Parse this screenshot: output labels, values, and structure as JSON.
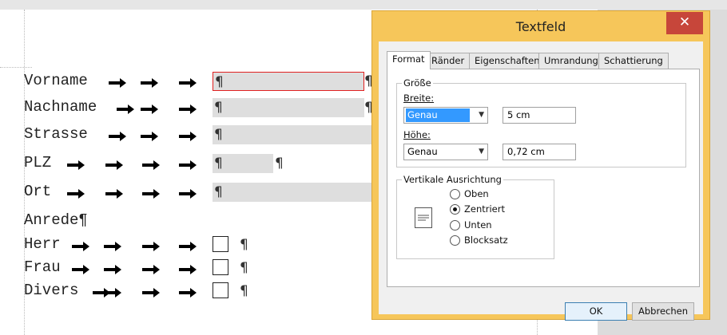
{
  "document": {
    "pilcrow": "¶",
    "rows": [
      {
        "label": "Vorname"
      },
      {
        "label": "Nachname"
      },
      {
        "label": "Strasse"
      },
      {
        "label": "PLZ"
      },
      {
        "label": "Ort"
      }
    ],
    "anrede": {
      "label": "Anrede¶"
    },
    "checkboxes": [
      {
        "label": "Herr"
      },
      {
        "label": "Frau"
      },
      {
        "label": "Divers"
      }
    ]
  },
  "dialog": {
    "title": "Textfeld",
    "close": "✕",
    "tabs": [
      "Format",
      "Ränder",
      "Eigenschaften",
      "Umrandung",
      "Schattierung"
    ],
    "selected_tab": "Format",
    "size_group": {
      "legend": "Größe",
      "width_label": "Breite:",
      "width_mode": "Genau",
      "width_value": "5 cm",
      "height_label": "Höhe:",
      "height_mode": "Genau",
      "height_value": "0,72 cm"
    },
    "align_group": {
      "legend": "Vertikale Ausrichtung",
      "options": [
        "Oben",
        "Zentriert",
        "Unten",
        "Blocksatz"
      ],
      "selected": "Zentriert"
    },
    "ok": "OK",
    "cancel": "Abbrechen"
  },
  "colors": {
    "dialog_frame": "#f6c65a",
    "close_button": "#c7463a",
    "field_fill": "#dedede",
    "active_field_border": "#e02020",
    "selection": "#3399ff"
  }
}
